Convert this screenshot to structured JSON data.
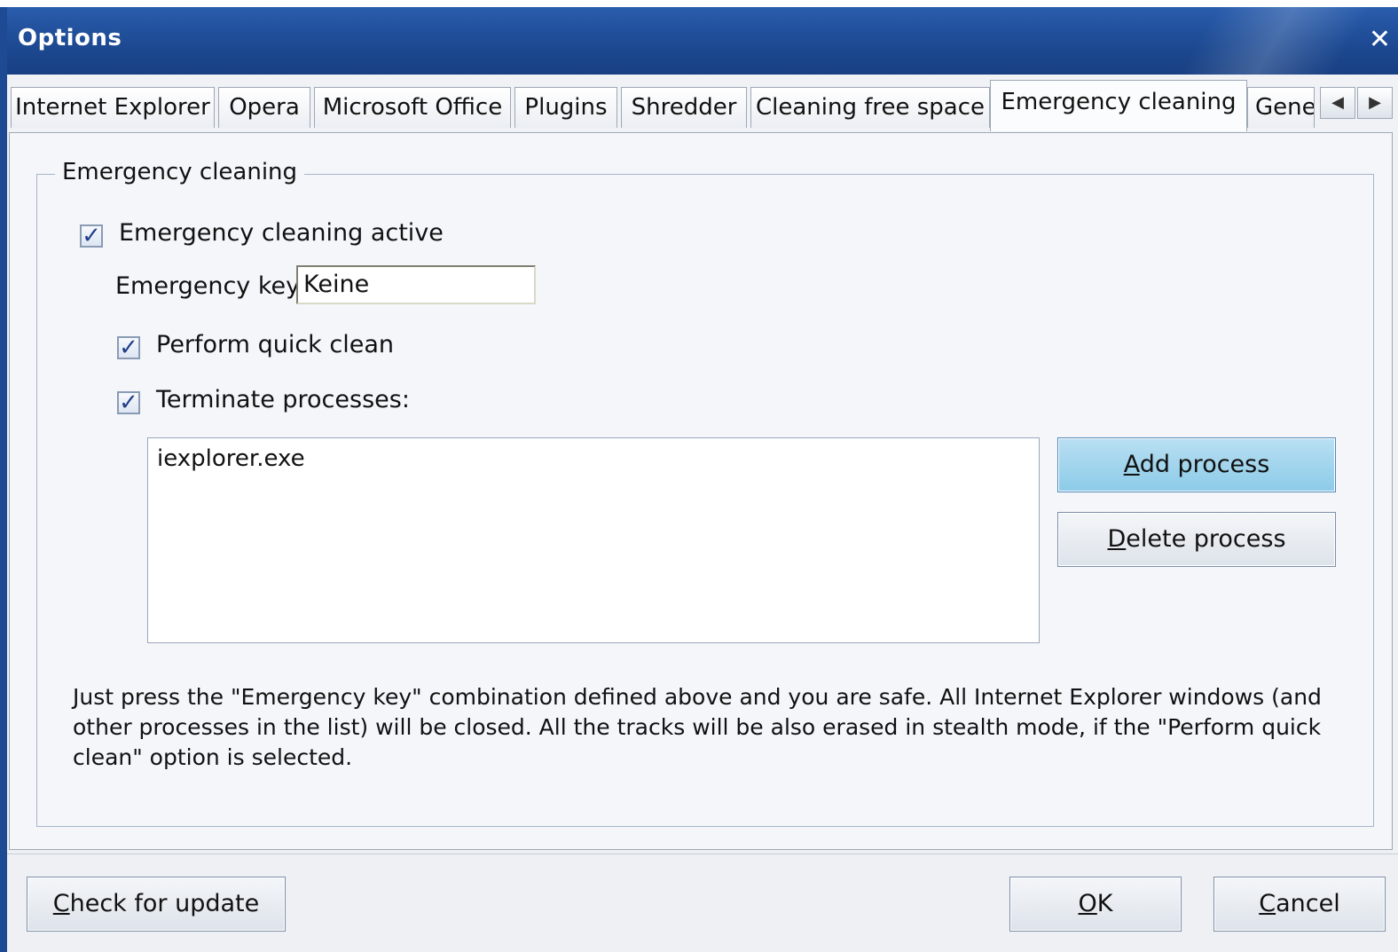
{
  "window": {
    "title": "Options"
  },
  "tabs": [
    {
      "label": "Internet Explorer"
    },
    {
      "label": "Opera"
    },
    {
      "label": "Microsoft Office"
    },
    {
      "label": "Plugins"
    },
    {
      "label": "Shredder"
    },
    {
      "label": "Cleaning free space"
    },
    {
      "label": "Emergency cleaning"
    },
    {
      "label": "Gene"
    }
  ],
  "active_tab": "Emergency cleaning",
  "group": {
    "title": "Emergency cleaning",
    "active_checkbox": {
      "label": "Emergency cleaning active",
      "checked": true
    },
    "key_label": "Emergency key:",
    "key_value": "Keine",
    "quick_clean": {
      "label": "Perform quick clean",
      "checked": true
    },
    "terminate": {
      "label": "Terminate processes:",
      "checked": true
    },
    "processes": [
      "iexplorer.exe"
    ],
    "add_button": {
      "accel": "A",
      "rest": "dd process"
    },
    "delete_button": {
      "accel": "D",
      "rest": "elete process"
    },
    "description": "Just press the \"Emergency key\" combination defined above and you are safe. All Internet Explorer windows (and other processes in the list) will be closed. All the tracks will be also erased in stealth mode, if the \"Perform quick clean\" option is selected."
  },
  "footer": {
    "check_update": {
      "accel": "C",
      "rest": "heck for update"
    },
    "ok": {
      "accel": "O",
      "rest": "K"
    },
    "cancel": {
      "accel": "C",
      "rest": "ancel"
    }
  },
  "colors": {
    "title_bar": "#1d4a93",
    "hot_button": "#a9d8ef",
    "checkmark": "#1f3f8a"
  },
  "icons": {
    "close": "close-icon",
    "check": "checkmark-icon",
    "scroll_left": "arrow-left-icon",
    "scroll_right": "arrow-right-icon"
  }
}
